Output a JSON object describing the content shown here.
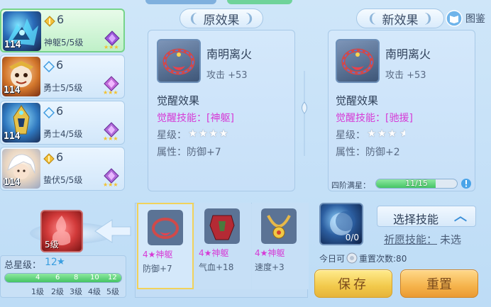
{
  "colors": {
    "accent_magenta": "#d63ad6",
    "progress_green": "#45c465",
    "button_yellow": "#f2c94b",
    "button_orange": "#f5b34b"
  },
  "heroes": [
    {
      "grade": "6",
      "status": "神躯5/5级",
      "level": "114",
      "active": true
    },
    {
      "grade": "6",
      "status": "勇士5/5级",
      "level": "114",
      "active": false
    },
    {
      "grade": "6",
      "status": "勇士4/5级",
      "level": "114",
      "active": false
    },
    {
      "grade": "6",
      "status": "蛰伏5/5级",
      "level": "114",
      "active": false
    }
  ],
  "original": {
    "title": "原效果",
    "equip_name": "南明离火",
    "equip_stat": "攻击 +53",
    "awaken_title": "觉醒效果",
    "skill_line": "觉醒技能：[神躯]",
    "star_label": "星级：",
    "stars": "★★★★",
    "attr_line": "属性：防御+7"
  },
  "new_effect": {
    "title": "新效果",
    "equip_name": "南明离火",
    "equip_stat": "攻击 +53",
    "awaken_title": "觉醒效果",
    "skill_line": "觉醒技能：[驰援]",
    "star_label": "星级：",
    "stars": "★★★",
    "star_half": "★",
    "attr_line": "属性：防御+2",
    "progress_label": "四阶满星：",
    "progress_text": "11/15",
    "progress_fraction": 0.733
  },
  "handbook_label": "图鉴",
  "total_star": {
    "label": "总星级：",
    "value": "12",
    "star": "★",
    "progress_fraction": 1.0,
    "ticks": [
      "4",
      "6",
      "8",
      "10",
      "12"
    ],
    "levels": [
      "1级",
      "2级",
      "3级",
      "4级",
      "5级"
    ]
  },
  "current_level_badge": "5级",
  "inventory": [
    {
      "name": "4★神躯",
      "stat": "防御+7",
      "selected": true
    },
    {
      "name": "4★神躯",
      "stat": "气血+18",
      "selected": false
    },
    {
      "name": "4★神躯",
      "stat": "速度+3",
      "selected": false
    }
  ],
  "skill_selector": {
    "orb_count": "0/0",
    "select_label": "选择技能",
    "chevron": "︿",
    "wish_label": "祈愿技能：",
    "wish_value": "未选",
    "reset_info_prefix": "今日可",
    "reset_info_suffix": "重置次数:80"
  },
  "buttons": {
    "save": "保存",
    "reset": "重置"
  }
}
